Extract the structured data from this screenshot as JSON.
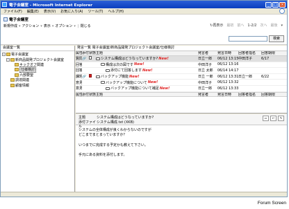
{
  "window": {
    "title": "電子会議室 - Microsoft Internet Explorer"
  },
  "menu": [
    "ファイル(F)",
    "編集(E)",
    "表示(V)",
    "お気に入り(A)",
    "ツール(T)",
    "ヘルプ(H)"
  ],
  "app": {
    "title": "電子会議室",
    "toolbar": [
      "新規作成",
      "アクション",
      "表示",
      "オプション",
      "閉じる"
    ],
    "nav": {
      "refresh": "再表示",
      "first": "最初",
      "prev": "前へ",
      "page": "1-2/2",
      "next": "次へ",
      "last": "最後"
    },
    "search_button": "検索"
  },
  "sidebar": {
    "header": "会議室一覧",
    "items": [
      {
        "label": "電子会議室",
        "level": 0,
        "toggle": "-"
      },
      {
        "label": "新商品開発プロジェクト会議室",
        "level": 1,
        "toggle": "-"
      },
      {
        "label": "キックオフ関連",
        "level": 2,
        "toggle": ""
      },
      {
        "label": "仕様検討",
        "level": 2,
        "toggle": "",
        "selected": true
      },
      {
        "label": "六部要望",
        "level": 2,
        "toggle": ""
      },
      {
        "label": "調達関連",
        "level": 1,
        "toggle": ""
      },
      {
        "label": "顧客情報",
        "level": 1,
        "toggle": ""
      }
    ]
  },
  "list": {
    "path": "発言一覧 電子会議室/新商品開発プロジェクト会議室/仕様検討",
    "columns": [
      "属性",
      "添付",
      "状態",
      "主題",
      "発言者",
      "発言日時",
      "回答者指名",
      "回答期限"
    ],
    "rows": [
      {
        "type": "質問",
        "att": "🔗",
        "state": "doc",
        "indent": 0,
        "subject": "システム構成はどうなっていますか?",
        "new": "New!",
        "poster": "日立一郎",
        "date": "06/12 13:15",
        "respondent": "中田洋子",
        "deadline": "6/17"
      },
      {
        "type": "回答",
        "att": "",
        "state": "",
        "indent": 1,
        "subject": "構成は次の図です",
        "new": "New!",
        "poster": "中田洋子",
        "date": "06/12 13:16",
        "respondent": "",
        "deadline": ""
      },
      {
        "type": "回答",
        "att": "",
        "state": "",
        "indent": 2,
        "subject": "添付にて回答します",
        "new": "New!",
        "poster": "日立 太郎",
        "date": "06/14 14:17",
        "respondent": "",
        "deadline": ""
      },
      {
        "type": "課題",
        "att": "🔗",
        "state": "red",
        "indent": 0,
        "subject": "バックアップ機能",
        "new": "New!",
        "poster": "日立 一郎",
        "date": "06/12 13:31",
        "respondent": "日立一郎",
        "deadline": "6/22"
      },
      {
        "type": "意見",
        "att": "",
        "state": "",
        "indent": 1,
        "subject": "バックアップ機能について",
        "new": "New!",
        "poster": "中田洋子",
        "date": "06/12 13:32",
        "respondent": "",
        "deadline": ""
      },
      {
        "type": "意見",
        "att": "",
        "state": "",
        "indent": 2,
        "subject": "バックアップ機能について補足",
        "new": "New!",
        "poster": "日立一郎",
        "date": "06/12 13:33",
        "respondent": "",
        "deadline": ""
      }
    ]
  },
  "detail": {
    "subject_label": "主題",
    "subject": "システム構成はどうなっていますか?",
    "attachment_label": "添付ファイル",
    "attachment": "システム構成.txt (XKB)",
    "body": [
      "システムの全体構成が良くわからないのですが",
      "どこまでまとまっていますか？",
      "",
      "いつまでに完成する予定かも教えて下さい。",
      "",
      "手元にある資料を添付します。"
    ]
  },
  "caption": "Forum Screen"
}
